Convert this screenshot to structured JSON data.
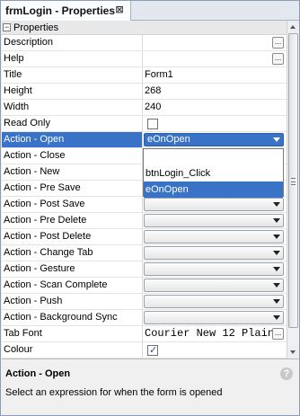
{
  "tab": {
    "title": "frmLogin - Properties",
    "close_icon": "⊠"
  },
  "category": {
    "label": "Properties",
    "toggle": "−"
  },
  "rows": [
    {
      "name": "Description",
      "value": "",
      "editor": "ellipsis"
    },
    {
      "name": "Help",
      "value": "",
      "editor": "ellipsis"
    },
    {
      "name": "Title",
      "value": "Form1",
      "editor": "text"
    },
    {
      "name": "Height",
      "value": "268",
      "editor": "text"
    },
    {
      "name": "Width",
      "value": "240",
      "editor": "text"
    },
    {
      "name": "Read Only",
      "value": "",
      "editor": "checkbox",
      "checked": false
    },
    {
      "name": "Action - Open",
      "value": "eOnOpen",
      "editor": "combo",
      "selected": true
    },
    {
      "name": "Action - Close",
      "value": "",
      "editor": "combo"
    },
    {
      "name": "Action - New",
      "value": "",
      "editor": "combo"
    },
    {
      "name": "Action - Pre Save",
      "value": "",
      "editor": "combo"
    },
    {
      "name": "Action - Post Save",
      "value": "",
      "editor": "combo"
    },
    {
      "name": "Action - Pre Delete",
      "value": "",
      "editor": "combo"
    },
    {
      "name": "Action - Post Delete",
      "value": "",
      "editor": "combo"
    },
    {
      "name": "Action - Change Tab",
      "value": "",
      "editor": "combo"
    },
    {
      "name": "Action - Gesture",
      "value": "",
      "editor": "combo"
    },
    {
      "name": "Action - Scan Complete",
      "value": "",
      "editor": "combo"
    },
    {
      "name": "Action - Push",
      "value": "",
      "editor": "combo"
    },
    {
      "name": "Action - Background Sync",
      "value": "",
      "editor": "combo"
    },
    {
      "name": "Tab Font",
      "value": "Courier New 12 Plain",
      "editor": "ellipsis-mono"
    },
    {
      "name": "Colour",
      "value": "",
      "editor": "checkbox",
      "checked": true
    }
  ],
  "dropdown": {
    "options": [
      "",
      "btnLogin_Click",
      "eOnOpen"
    ],
    "highlighted": "eOnOpen"
  },
  "ellipsis_label": "...",
  "description": {
    "title": "Action - Open",
    "text": "Select an expression for when the form is opened",
    "help_icon": "?"
  },
  "colors": {
    "selection": "#3873c8",
    "border": "#8e9db3"
  }
}
